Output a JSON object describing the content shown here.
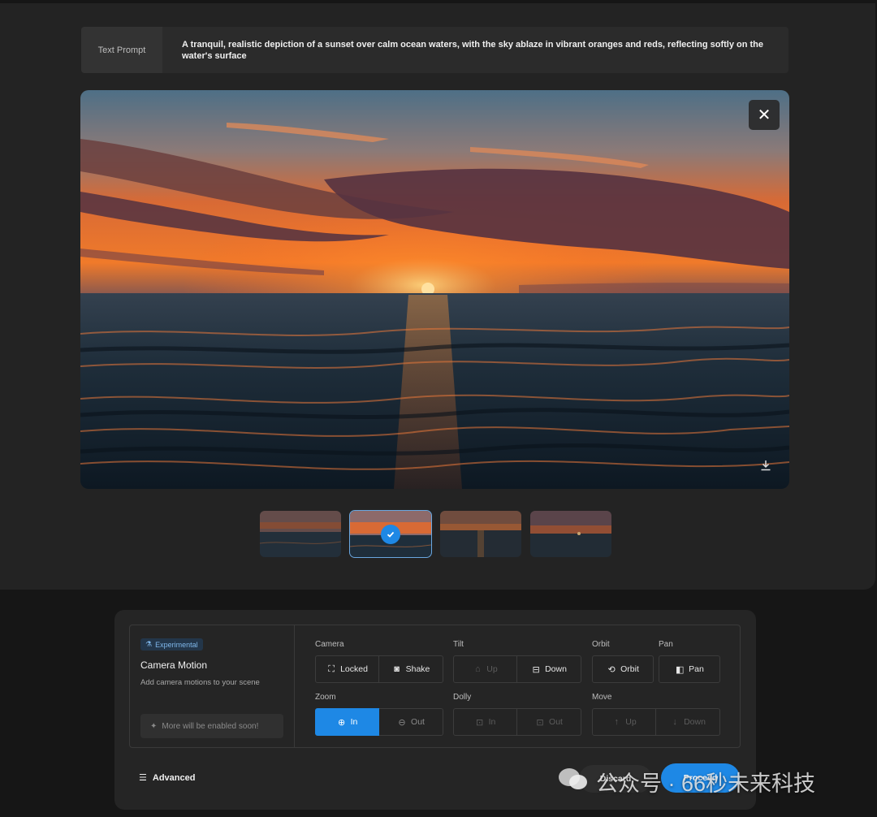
{
  "prompt": {
    "label": "Text Prompt",
    "text": "A tranquil, realistic depiction of a sunset over calm ocean waters, with the sky ablaze in vibrant oranges and reds, reflecting softly on the water's surface"
  },
  "preview": {
    "close_icon": "close-icon",
    "download_icon": "download-icon"
  },
  "thumbnails": {
    "count": 4,
    "selected_index": 1
  },
  "camera_motion": {
    "badge": "Experimental",
    "title": "Camera Motion",
    "description": "Add camera motions to your scene",
    "soon": "More will be enabled soon!",
    "camera": {
      "label": "Camera",
      "locked": "Locked",
      "shake": "Shake"
    },
    "tilt": {
      "label": "Tilt",
      "up": "Up",
      "down": "Down"
    },
    "orbit": {
      "label": "Orbit",
      "button": "Orbit"
    },
    "pan": {
      "label": "Pan",
      "button": "Pan"
    },
    "zoom": {
      "label": "Zoom",
      "in": "In",
      "out": "Out"
    },
    "dolly": {
      "label": "Dolly",
      "in": "In",
      "out": "Out"
    },
    "move": {
      "label": "Move",
      "up": "Up",
      "down": "Down"
    }
  },
  "footer": {
    "advanced": "Advanced",
    "discard": "Discard",
    "proceed": "Proceed"
  },
  "watermark": {
    "text": "公众号 · 66秒未来科技"
  },
  "colors": {
    "accent": "#1e88e5",
    "panel": "#232323",
    "badge": "#7fb7ea"
  }
}
